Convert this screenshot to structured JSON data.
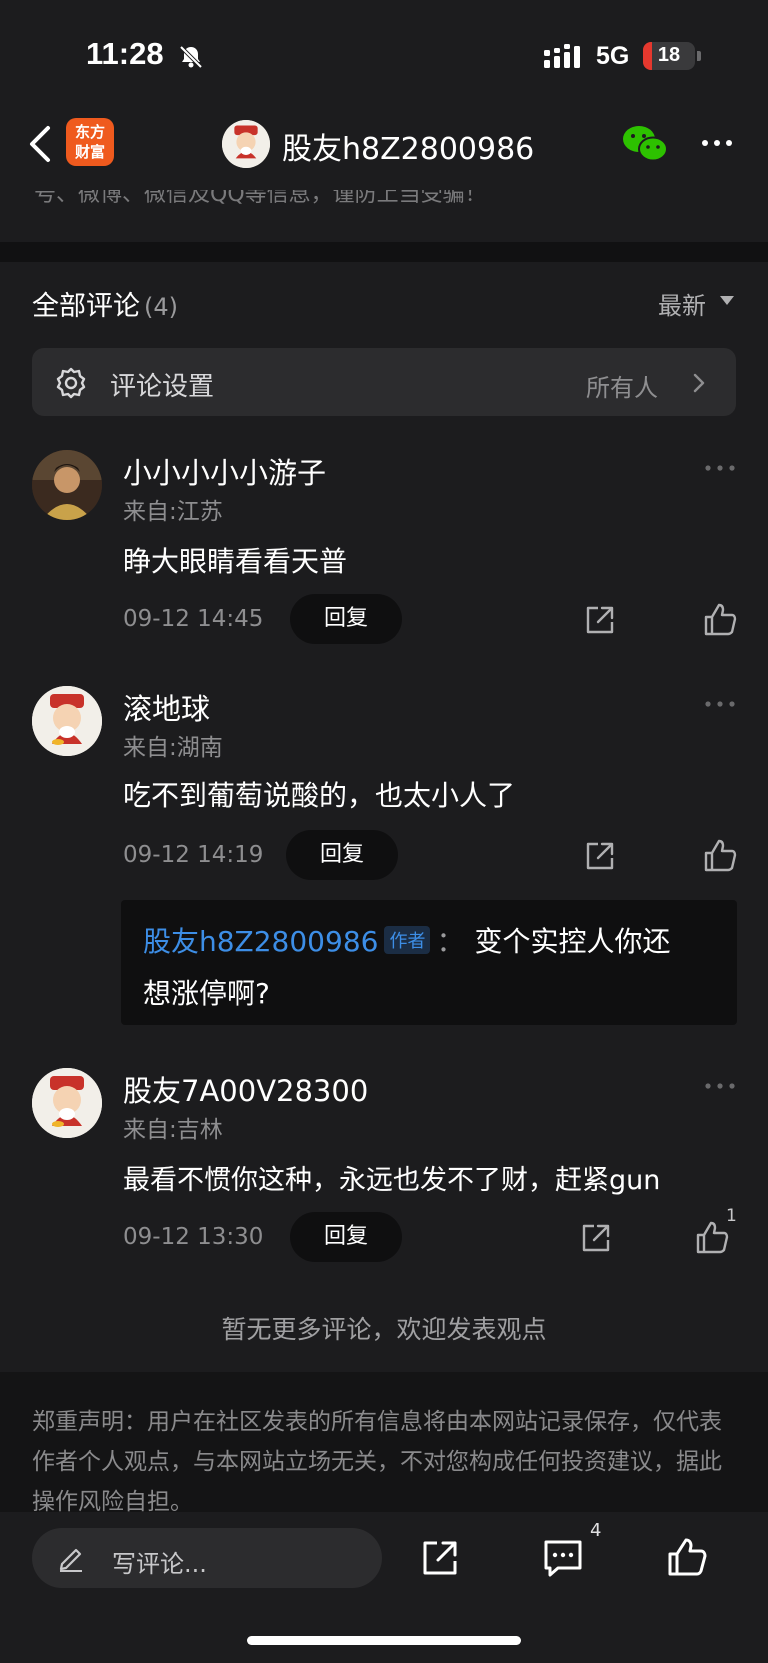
{
  "status_bar": {
    "time": "11:28",
    "network": "5G",
    "battery": "18",
    "battery_level": 0.18
  },
  "nav": {
    "logo_text": "东方财富",
    "title": "股友h8Z2800986"
  },
  "notice_fragment": "号、微博、微信及QQ等信息，谨防上当受骗！",
  "comments_header": {
    "title": "全部评论",
    "count": "(4)",
    "sort": "最新"
  },
  "settings": {
    "label": "评论设置",
    "value": "所有人"
  },
  "comments": [
    {
      "name": "小小小小小游子",
      "location": "来自:江苏",
      "text": "睁大眼睛看看天普",
      "time": "09-12 14:45",
      "reply_label": "回复"
    },
    {
      "name": "滚地球",
      "location": "来自:湖南",
      "text": "吃不到葡萄说酸的，也太小人了",
      "time": "09-12 14:19",
      "reply_label": "回复",
      "reply": {
        "author": "股友h8Z2800986",
        "tag": "作者",
        "sep": "：",
        "text1": "变个实控人你还",
        "text2": "想涨停啊?"
      }
    },
    {
      "name": "股友7A00V28300",
      "location": "来自:吉林",
      "text": "最看不惯你这种，永远也发不了财，赶紧gun",
      "time": "09-12 13:30",
      "reply_label": "回复",
      "likes": "1"
    }
  ],
  "no_more": "暂无更多评论，欢迎发表观点",
  "disclaimer": "郑重声明：用户在社区发表的所有信息将由本网站记录保存，仅代表作者个人观点，与本网站立场无关，不对您构成任何投资建议，据此操作风险自担。",
  "bottom_bar": {
    "write_placeholder": "写评论...",
    "comment_count": "4"
  },
  "icons": [
    "bell-off-icon",
    "signal-icon",
    "back-icon",
    "wechat-icon",
    "more-icon",
    "gear-icon",
    "chevron-right-icon",
    "sort-down-icon",
    "share-icon",
    "like-icon",
    "pencil-icon",
    "comment-icon"
  ]
}
